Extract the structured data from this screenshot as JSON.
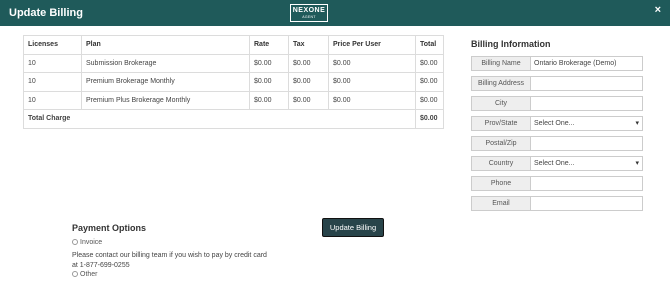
{
  "modal": {
    "title": "Update Billing",
    "logo_main": "NEXONE",
    "logo_sub": "AGENT",
    "close_label": "×"
  },
  "table": {
    "headers": [
      "Licenses",
      "Plan",
      "Rate",
      "Tax",
      "Price Per User",
      "Total"
    ],
    "rows": [
      {
        "licenses": "10",
        "plan": "Submission Brokerage",
        "rate": "$0.00",
        "tax": "$0.00",
        "price_per_user": "$0.00",
        "total": "$0.00"
      },
      {
        "licenses": "10",
        "plan": "Premium Brokerage Monthly",
        "rate": "$0.00",
        "tax": "$0.00",
        "price_per_user": "$0.00",
        "total": "$0.00"
      },
      {
        "licenses": "10",
        "plan": "Premium Plus Brokerage Monthly",
        "rate": "$0.00",
        "tax": "$0.00",
        "price_per_user": "$0.00",
        "total": "$0.00"
      }
    ],
    "total_label": "Total Charge",
    "total_value": "$0.00"
  },
  "billing_info": {
    "title": "Billing Information",
    "fields": [
      {
        "label": "Billing Name",
        "value": "Ontario Brokerage (Demo)",
        "type": "input"
      },
      {
        "label": "Billing Address",
        "value": "",
        "type": "input"
      },
      {
        "label": "City",
        "value": "",
        "type": "input"
      },
      {
        "label": "Prov/State",
        "value": "Select One...",
        "type": "select"
      },
      {
        "label": "Postal/Zip",
        "value": "",
        "type": "input"
      },
      {
        "label": "Country",
        "value": "Select One...",
        "type": "select"
      },
      {
        "label": "Phone",
        "value": "",
        "type": "input"
      },
      {
        "label": "Email",
        "value": "",
        "type": "input"
      }
    ]
  },
  "payment": {
    "title": "Payment Options",
    "option_invoice": "Invoice",
    "note": "Please contact our billing team if you wish to pay by credit card at 1-877-699-0255",
    "option_other": "Other"
  },
  "update_button": "Update Billing",
  "colors": {
    "header_bg": "#1f5a5a",
    "button_bg": "#28444a"
  },
  "icons": {
    "close": "close-icon",
    "select_arrow": "chevron-down-icon",
    "radio": "radio-icon"
  }
}
